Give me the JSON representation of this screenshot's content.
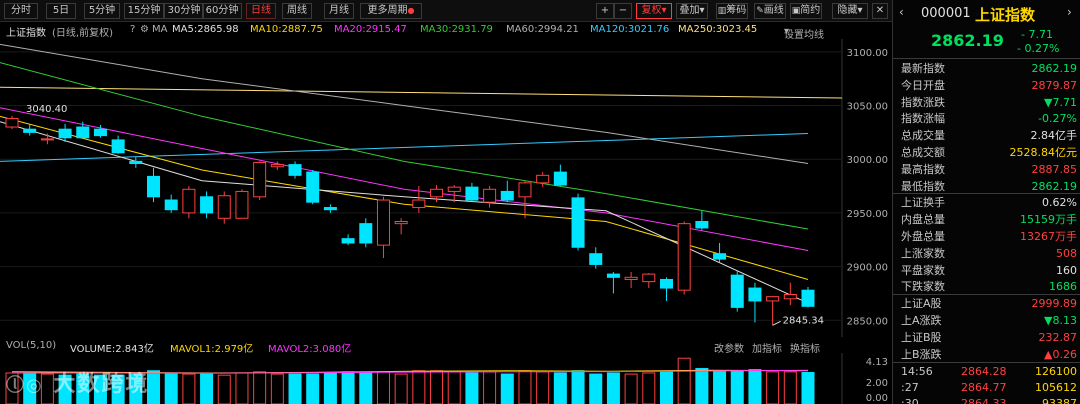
{
  "toolbar": {
    "periods": [
      "分时",
      "5日",
      "5分钟",
      "15分钟",
      "30分钟",
      "60分钟",
      "日线",
      "周线",
      "月线",
      "更多周期"
    ],
    "active_period": "日线",
    "right_buttons": [
      "+",
      "−",
      "复权",
      "叠加",
      "筹码",
      "画线",
      "简约",
      "隐藏"
    ],
    "active_button": "复权"
  },
  "legend": {
    "title": "上证指数",
    "mode": "(日线,前复权)",
    "ma_label": "MA",
    "ma5": "MA5:2865.98",
    "ma10": "MA10:2887.75",
    "ma20": "MA20:2915.47",
    "ma30": "MA30:2931.79",
    "ma60": "MA60:2994.21",
    "ma120": "MA120:3021.76",
    "ma250": "MA250:3023.45",
    "settings": "设置均线"
  },
  "colors": {
    "up": "#ff4040",
    "down": "#00e5ff",
    "ma5": "#e0e0e0",
    "ma10": "#ffd700",
    "ma20": "#ff33ff",
    "ma30": "#33cc33",
    "ma60": "#b0b0b0",
    "ma120": "#33ccff",
    "ma250": "#ffe07a"
  },
  "chart_data": {
    "type": "candlestick",
    "y_ticks": [
      "3100.00",
      "3050.00",
      "3000.00",
      "2950.00",
      "2900.00",
      "2850.00"
    ],
    "ylim": [
      2840,
      3112
    ],
    "annotations": {
      "high": "3040.40",
      "low": "2845.34"
    },
    "candles": [
      [
        3030,
        3040.4,
        3028,
        3038
      ],
      [
        3028,
        3033,
        3022,
        3025
      ],
      [
        3018,
        3024,
        3014,
        3019
      ],
      [
        3028,
        3033,
        3016,
        3020
      ],
      [
        3030,
        3035,
        3020,
        3020
      ],
      [
        3028,
        3032,
        3020,
        3022
      ],
      [
        3018,
        3022,
        3005,
        3006
      ],
      [
        2998,
        3002,
        2992,
        2996
      ],
      [
        2984,
        2992,
        2960,
        2965
      ],
      [
        2962,
        2967,
        2950,
        2953
      ],
      [
        2950,
        2975,
        2945,
        2972
      ],
      [
        2965,
        2970,
        2945,
        2950
      ],
      [
        2945,
        2970,
        2940,
        2966
      ],
      [
        2945,
        2972,
        2945,
        2970
      ],
      [
        2965,
        2998,
        2962,
        2997
      ],
      [
        2993,
        2998,
        2990,
        2995
      ],
      [
        2995,
        2998,
        2982,
        2985
      ],
      [
        2988,
        2990,
        2958,
        2960
      ],
      [
        2955,
        2958,
        2950,
        2953
      ],
      [
        2926,
        2930,
        2920,
        2922
      ],
      [
        2940,
        2945,
        2918,
        2922
      ],
      [
        2920,
        2965,
        2908,
        2962
      ],
      [
        2940,
        2945,
        2930,
        2942
      ],
      [
        2955,
        2975,
        2950,
        2962
      ],
      [
        2965,
        2976,
        2960,
        2972
      ],
      [
        2970,
        2976,
        2960,
        2974
      ],
      [
        2974,
        2978,
        2960,
        2962
      ],
      [
        2960,
        2975,
        2955,
        2972
      ],
      [
        2970,
        2980,
        2960,
        2962
      ],
      [
        2965,
        2980,
        2945,
        2978
      ],
      [
        2978,
        2988,
        2974,
        2985
      ],
      [
        2988,
        2995,
        2975,
        2976
      ],
      [
        2964,
        2968,
        2915,
        2918
      ],
      [
        2912,
        2918,
        2898,
        2902
      ],
      [
        2893,
        2895,
        2875,
        2890
      ],
      [
        2888,
        2895,
        2880,
        2890
      ],
      [
        2886,
        2894,
        2880,
        2893
      ],
      [
        2888,
        2890,
        2868,
        2880
      ],
      [
        2878,
        2942,
        2874,
        2940
      ],
      [
        2942,
        2952,
        2934,
        2936
      ],
      [
        2912,
        2922,
        2904,
        2907
      ],
      [
        2892,
        2896,
        2858,
        2862
      ],
      [
        2880,
        2885,
        2848,
        2868
      ],
      [
        2868,
        2872,
        2845.34,
        2872
      ],
      [
        2870,
        2885,
        2864,
        2874
      ],
      [
        2878,
        2881,
        2862,
        2863
      ]
    ],
    "ma_lines": {
      "ma250": [
        3067,
        3057
      ],
      "ma120": [
        2998,
        3024
      ],
      "ma60": [
        3107,
        3075,
        3050,
        3025,
        2996
      ],
      "ma30": [
        3090,
        3040,
        2998,
        2968,
        2935
      ],
      "ma20": [
        3048,
        3010,
        2972,
        2950,
        2915
      ],
      "ma10": [
        3040,
        2990,
        2958,
        2942,
        2888
      ],
      "ma5": [
        3035,
        2980,
        2965,
        2952,
        2866
      ]
    }
  },
  "volume_info": {
    "title": "VOL(5,10)",
    "volume": "VOLUME:2.843亿",
    "mavol1": "MAVOL1:2.979亿",
    "mavol2": "MAVOL2:3.080亿",
    "actions": [
      "改参数",
      "加指标",
      "换指标"
    ],
    "y_ticks": [
      "4.13",
      "2.00",
      "0.00"
    ]
  },
  "volume_data": [
    2.8,
    2.82,
    2.7,
    2.6,
    2.7,
    2.6,
    2.6,
    2.8,
    3.0,
    2.8,
    2.7,
    2.8,
    2.6,
    2.8,
    2.9,
    2.7,
    2.7,
    2.7,
    2.8,
    2.9,
    2.8,
    2.9,
    2.7,
    3.0,
    3.0,
    2.9,
    2.8,
    2.9,
    2.7,
    3.0,
    2.9,
    2.8,
    3.0,
    2.7,
    2.8,
    2.7,
    2.8,
    2.9,
    4.13,
    3.2,
    3.0,
    3.0,
    3.1,
    2.9,
    2.9,
    2.84
  ],
  "panel": {
    "code": "000001",
    "name": "上证指数",
    "price": "2862.19",
    "change": "- 7.71",
    "pct": "- 0.27%",
    "rows": [
      {
        "k": "最新指数",
        "v": "2862.19",
        "c": "grn"
      },
      {
        "k": "今日开盘",
        "v": "2879.87",
        "c": "red"
      },
      {
        "k": "指数涨跌",
        "v": "▼7.71",
        "c": "grn"
      },
      {
        "k": "指数涨幅",
        "v": "-0.27%",
        "c": "grn"
      },
      {
        "k": "总成交量",
        "v": "2.84亿手",
        "c": "wht"
      },
      {
        "k": "总成交额",
        "v": "2528.84亿元",
        "c": "yel"
      },
      {
        "k": "最高指数",
        "v": "2887.85",
        "c": "red"
      },
      {
        "k": "最低指数",
        "v": "2862.19",
        "c": "grn"
      },
      {
        "k": "上证换手",
        "v": "0.62%",
        "c": "wht"
      },
      {
        "k": "内盘总量",
        "v": "15159万手",
        "c": "grn"
      },
      {
        "k": "外盘总量",
        "v": "13267万手",
        "c": "red"
      },
      {
        "k": "上涨家数",
        "v": "508",
        "c": "red"
      },
      {
        "k": "平盘家数",
        "v": "160",
        "c": "wht"
      },
      {
        "k": "下跌家数",
        "v": "1686",
        "c": "grn"
      },
      {
        "k": "上证A股",
        "v": "2999.89",
        "c": "red"
      },
      {
        "k": "上A涨跌",
        "v": "▼8.13",
        "c": "grn"
      },
      {
        "k": "上证B股",
        "v": "232.87",
        "c": "red"
      },
      {
        "k": "上B涨跌",
        "v": "▲0.26",
        "c": "red"
      }
    ],
    "ticks": [
      {
        "t": "14:56",
        "p": "2864.28",
        "v": "126100"
      },
      {
        "t": ":27",
        "p": "2864.77",
        "v": "105612"
      },
      {
        "t": ":30",
        "p": "2864.33",
        "v": "93387"
      }
    ]
  },
  "watermark": "大数跨境"
}
